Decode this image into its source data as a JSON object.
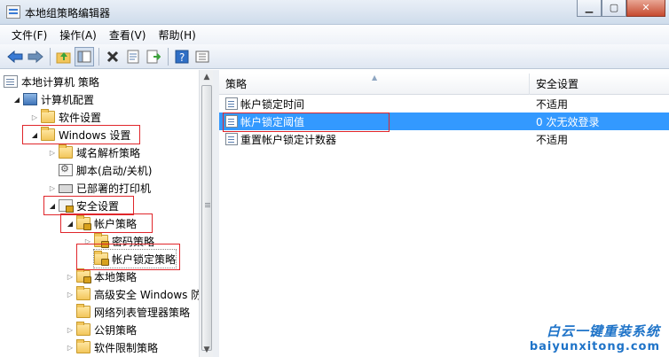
{
  "window": {
    "title": "本地组策略编辑器"
  },
  "menu": [
    "文件(F)",
    "操作(A)",
    "查看(V)",
    "帮助(H)"
  ],
  "tree": {
    "root": "本地计算机 策略",
    "computer_config": "计算机配置",
    "software_settings": "软件设置",
    "windows_settings": "Windows 设置",
    "name_resolution": "域名解析策略",
    "scripts": "脚本(启动/关机)",
    "printers": "已部署的打印机",
    "security_settings": "安全设置",
    "account_policies": "帐户策略",
    "password_policy": "密码策略",
    "lockout_policy": "帐户锁定策略",
    "local_policies": "本地策略",
    "firewall": "高级安全 Windows 防",
    "network_list": "网络列表管理器策略",
    "public_key": "公钥策略",
    "software_restriction": "软件限制策略"
  },
  "list": {
    "headers": {
      "policy": "策略",
      "setting": "安全设置"
    },
    "rows": [
      {
        "policy": "帐户锁定时间",
        "setting": "不适用"
      },
      {
        "policy": "帐户锁定阈值",
        "setting": "0 次无效登录"
      },
      {
        "policy": "重置帐户锁定计数器",
        "setting": "不适用"
      }
    ]
  },
  "watermark": {
    "line1": "白云一键重装系统",
    "line2": "baiyunxitong.com"
  },
  "colors": {
    "selection": "#3399ff",
    "annotation": "#e0262b"
  }
}
